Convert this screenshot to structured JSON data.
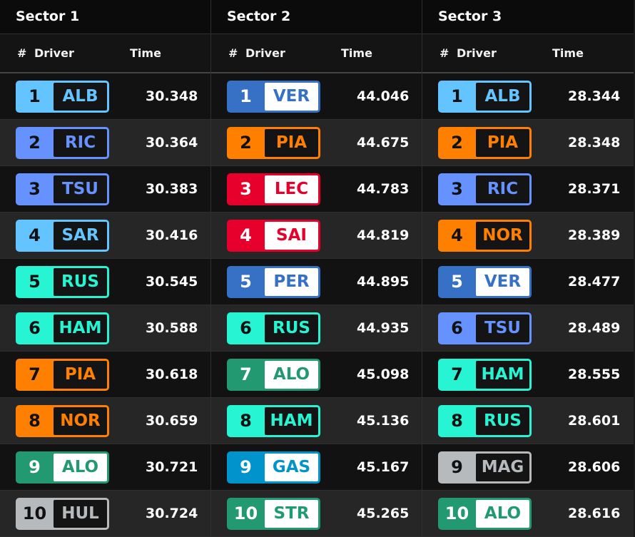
{
  "sectors": [
    {
      "title": "Sector 1",
      "headers": {
        "pos": "#",
        "driver": "Driver",
        "time": "Time"
      },
      "rows": [
        {
          "pos": "1",
          "code": "ALB",
          "time": "30.348",
          "color": "#64c4ff",
          "style": "dark"
        },
        {
          "pos": "2",
          "code": "RIC",
          "time": "30.364",
          "color": "#6692ff",
          "style": "dark"
        },
        {
          "pos": "3",
          "code": "TSU",
          "time": "30.383",
          "color": "#6692ff",
          "style": "dark"
        },
        {
          "pos": "4",
          "code": "SAR",
          "time": "30.416",
          "color": "#64c4ff",
          "style": "dark"
        },
        {
          "pos": "5",
          "code": "RUS",
          "time": "30.545",
          "color": "#27f4d2",
          "style": "dark"
        },
        {
          "pos": "6",
          "code": "HAM",
          "time": "30.588",
          "color": "#27f4d2",
          "style": "dark"
        },
        {
          "pos": "7",
          "code": "PIA",
          "time": "30.618",
          "color": "#ff8000",
          "style": "dark"
        },
        {
          "pos": "8",
          "code": "NOR",
          "time": "30.659",
          "color": "#ff8000",
          "style": "dark"
        },
        {
          "pos": "9",
          "code": "ALO",
          "time": "30.721",
          "color": "#229971",
          "style": "light"
        },
        {
          "pos": "10",
          "code": "HUL",
          "time": "30.724",
          "color": "#b6babd",
          "style": "dark"
        }
      ]
    },
    {
      "title": "Sector 2",
      "headers": {
        "pos": "#",
        "driver": "Driver",
        "time": "Time"
      },
      "rows": [
        {
          "pos": "1",
          "code": "VER",
          "time": "44.046",
          "color": "#3671c6",
          "style": "light"
        },
        {
          "pos": "2",
          "code": "PIA",
          "time": "44.675",
          "color": "#ff8000",
          "style": "dark"
        },
        {
          "pos": "3",
          "code": "LEC",
          "time": "44.783",
          "color": "#e8002d",
          "style": "light"
        },
        {
          "pos": "4",
          "code": "SAI",
          "time": "44.819",
          "color": "#e8002d",
          "style": "light"
        },
        {
          "pos": "5",
          "code": "PER",
          "time": "44.895",
          "color": "#3671c6",
          "style": "light"
        },
        {
          "pos": "6",
          "code": "RUS",
          "time": "44.935",
          "color": "#27f4d2",
          "style": "dark"
        },
        {
          "pos": "7",
          "code": "ALO",
          "time": "45.098",
          "color": "#229971",
          "style": "light"
        },
        {
          "pos": "8",
          "code": "HAM",
          "time": "45.136",
          "color": "#27f4d2",
          "style": "dark"
        },
        {
          "pos": "9",
          "code": "GAS",
          "time": "45.167",
          "color": "#0093cc",
          "style": "light"
        },
        {
          "pos": "10",
          "code": "STR",
          "time": "45.265",
          "color": "#229971",
          "style": "light"
        }
      ]
    },
    {
      "title": "Sector 3",
      "headers": {
        "pos": "#",
        "driver": "Driver",
        "time": "Time"
      },
      "rows": [
        {
          "pos": "1",
          "code": "ALB",
          "time": "28.344",
          "color": "#64c4ff",
          "style": "dark"
        },
        {
          "pos": "2",
          "code": "PIA",
          "time": "28.348",
          "color": "#ff8000",
          "style": "dark"
        },
        {
          "pos": "3",
          "code": "RIC",
          "time": "28.371",
          "color": "#6692ff",
          "style": "dark"
        },
        {
          "pos": "4",
          "code": "NOR",
          "time": "28.389",
          "color": "#ff8000",
          "style": "dark"
        },
        {
          "pos": "5",
          "code": "VER",
          "time": "28.477",
          "color": "#3671c6",
          "style": "light"
        },
        {
          "pos": "6",
          "code": "TSU",
          "time": "28.489",
          "color": "#6692ff",
          "style": "dark"
        },
        {
          "pos": "7",
          "code": "HAM",
          "time": "28.555",
          "color": "#27f4d2",
          "style": "dark"
        },
        {
          "pos": "8",
          "code": "RUS",
          "time": "28.601",
          "color": "#27f4d2",
          "style": "dark"
        },
        {
          "pos": "9",
          "code": "MAG",
          "time": "28.606",
          "color": "#b6babd",
          "style": "dark"
        },
        {
          "pos": "10",
          "code": "ALO",
          "time": "28.616",
          "color": "#229971",
          "style": "light"
        }
      ]
    }
  ]
}
